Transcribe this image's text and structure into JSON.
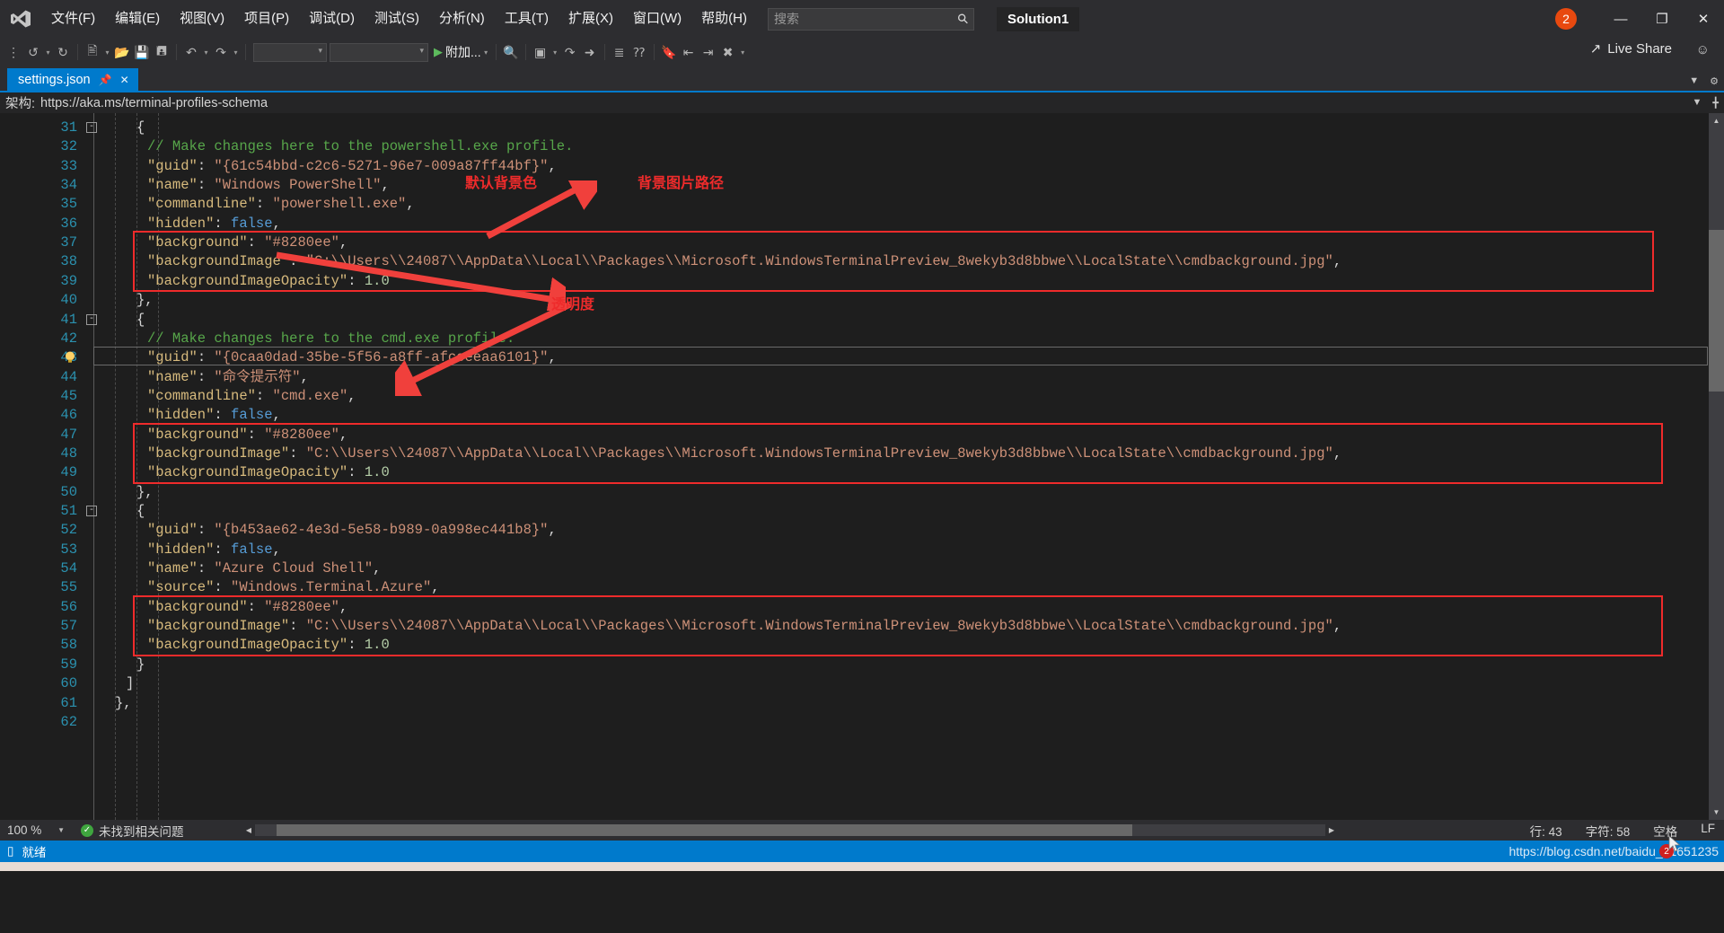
{
  "titlebar": {
    "logo_icon": "visual-studio-logo",
    "menus": [
      "文件(F)",
      "编辑(E)",
      "视图(V)",
      "项目(P)",
      "调试(D)",
      "测试(S)",
      "分析(N)",
      "工具(T)",
      "扩展(X)",
      "窗口(W)",
      "帮助(H)"
    ],
    "search_placeholder": "搜索",
    "search_value": "",
    "search_icon": "search-icon",
    "solution_name": "Solution1",
    "notification_count": "2",
    "minimize_icon": "minimize-icon",
    "maximize_icon": "maximize-icon",
    "close_icon": "close-icon"
  },
  "toolbar": {
    "back_icon": "navigate-back-icon",
    "forward_icon": "navigate-forward-icon",
    "new_project_icon": "new-project-icon",
    "open_icon": "open-file-icon",
    "save_icon": "save-icon",
    "save_all_icon": "save-all-icon",
    "undo_icon": "undo-icon",
    "redo_icon": "redo-icon",
    "config_combo": "",
    "platform_combo": "",
    "run_icon": "start-debug-icon",
    "attach_label": "附加...",
    "find_icon": "find-icon",
    "window_icon": "window-layout-icon",
    "indent_icon": "indent-icon",
    "comment_icon": "comment-icon",
    "bookmark_icon": "bookmark-icon",
    "live_share_label": "Live Share",
    "live_share_icon": "share-icon",
    "live_share_person_icon": "person-share-icon"
  },
  "tab": {
    "title": "settings.json",
    "pin_icon": "pin-icon",
    "close_icon": "close-tab-icon",
    "chevron_icon": "chevron-down-icon",
    "settings_icon": "gear-icon"
  },
  "schemabar": {
    "label": "架构:",
    "value": "https://aka.ms/terminal-profiles-schema",
    "chevron_icon": "chevron-down-icon",
    "split_icon": "split-editor-icon"
  },
  "editor": {
    "current_line": 43,
    "bulb_icon": "lightbulb-icon",
    "lines": [
      {
        "n": 31,
        "fold": "-",
        "indent": 3,
        "tokens": [
          {
            "t": "p",
            "v": "{"
          }
        ]
      },
      {
        "n": 32,
        "fold": "",
        "indent": 4,
        "tokens": [
          {
            "t": "c",
            "v": "// Make changes here to the powershell.exe profile."
          }
        ]
      },
      {
        "n": 33,
        "fold": "",
        "indent": 4,
        "tokens": [
          {
            "t": "k",
            "v": "\"guid\""
          },
          {
            "t": "p",
            "v": ": "
          },
          {
            "t": "s",
            "v": "\"{61c54bbd-c2c6-5271-96e7-009a87ff44bf}\""
          },
          {
            "t": "p",
            "v": ","
          }
        ]
      },
      {
        "n": 34,
        "fold": "",
        "indent": 4,
        "tokens": [
          {
            "t": "k",
            "v": "\"name\""
          },
          {
            "t": "p",
            "v": ": "
          },
          {
            "t": "s",
            "v": "\"Windows PowerShell\""
          },
          {
            "t": "p",
            "v": ","
          }
        ]
      },
      {
        "n": 35,
        "fold": "",
        "indent": 4,
        "tokens": [
          {
            "t": "k",
            "v": "\"commandline\""
          },
          {
            "t": "p",
            "v": ": "
          },
          {
            "t": "s",
            "v": "\"powershell.exe\""
          },
          {
            "t": "p",
            "v": ","
          }
        ]
      },
      {
        "n": 36,
        "fold": "",
        "indent": 4,
        "tokens": [
          {
            "t": "k",
            "v": "\"hidden\""
          },
          {
            "t": "p",
            "v": ": "
          },
          {
            "t": "b",
            "v": "false"
          },
          {
            "t": "p",
            "v": ","
          }
        ]
      },
      {
        "n": 37,
        "fold": "",
        "indent": 4,
        "tokens": [
          {
            "t": "k",
            "v": "\"background\""
          },
          {
            "t": "p",
            "v": ": "
          },
          {
            "t": "s",
            "v": "\"#8280ee\""
          },
          {
            "t": "p",
            "v": ","
          }
        ]
      },
      {
        "n": 38,
        "fold": "",
        "indent": 4,
        "tokens": [
          {
            "t": "k",
            "v": "\"backgroundImage\""
          },
          {
            "t": "p",
            "v": ": "
          },
          {
            "t": "s",
            "v": "\"C:\\\\Users\\\\24087\\\\AppData\\\\Local\\\\Packages\\\\Microsoft.WindowsTerminalPreview_8wekyb3d8bbwe\\\\LocalState\\\\cmdbackground.jpg\""
          },
          {
            "t": "p",
            "v": ","
          }
        ]
      },
      {
        "n": 39,
        "fold": "",
        "indent": 4,
        "tokens": [
          {
            "t": "k",
            "v": "\"backgroundImageOpacity\""
          },
          {
            "t": "p",
            "v": ": "
          },
          {
            "t": "n",
            "v": "1.0"
          }
        ]
      },
      {
        "n": 40,
        "fold": "",
        "indent": 3,
        "tokens": [
          {
            "t": "p",
            "v": "},"
          }
        ]
      },
      {
        "n": 41,
        "fold": "-",
        "indent": 3,
        "tokens": [
          {
            "t": "p",
            "v": "{"
          }
        ]
      },
      {
        "n": 42,
        "fold": "",
        "indent": 4,
        "tokens": [
          {
            "t": "c",
            "v": "// Make changes here to the cmd.exe profile."
          }
        ]
      },
      {
        "n": 43,
        "fold": "",
        "indent": 4,
        "tokens": [
          {
            "t": "k",
            "v": "\"guid\""
          },
          {
            "t": "p",
            "v": ": "
          },
          {
            "t": "s",
            "v": "\"{0caa0dad-35be-5f56-a8ff-afceeeaa6101}\""
          },
          {
            "t": "p",
            "v": ","
          }
        ]
      },
      {
        "n": 44,
        "fold": "",
        "indent": 4,
        "tokens": [
          {
            "t": "k",
            "v": "\"name\""
          },
          {
            "t": "p",
            "v": ": "
          },
          {
            "t": "s",
            "v": "\"命令提示符\""
          },
          {
            "t": "p",
            "v": ","
          }
        ]
      },
      {
        "n": 45,
        "fold": "",
        "indent": 4,
        "tokens": [
          {
            "t": "k",
            "v": "\"commandline\""
          },
          {
            "t": "p",
            "v": ": "
          },
          {
            "t": "s",
            "v": "\"cmd.exe\""
          },
          {
            "t": "p",
            "v": ","
          }
        ]
      },
      {
        "n": 46,
        "fold": "",
        "indent": 4,
        "tokens": [
          {
            "t": "k",
            "v": "\"hidden\""
          },
          {
            "t": "p",
            "v": ": "
          },
          {
            "t": "b",
            "v": "false"
          },
          {
            "t": "p",
            "v": ","
          }
        ]
      },
      {
        "n": 47,
        "fold": "",
        "indent": 4,
        "tokens": [
          {
            "t": "k",
            "v": "\"background\""
          },
          {
            "t": "p",
            "v": ": "
          },
          {
            "t": "s",
            "v": "\"#8280ee\""
          },
          {
            "t": "p",
            "v": ","
          }
        ]
      },
      {
        "n": 48,
        "fold": "",
        "indent": 4,
        "tokens": [
          {
            "t": "k",
            "v": "\"backgroundImage\""
          },
          {
            "t": "p",
            "v": ": "
          },
          {
            "t": "s",
            "v": "\"C:\\\\Users\\\\24087\\\\AppData\\\\Local\\\\Packages\\\\Microsoft.WindowsTerminalPreview_8wekyb3d8bbwe\\\\LocalState\\\\cmdbackground.jpg\""
          },
          {
            "t": "p",
            "v": ","
          }
        ]
      },
      {
        "n": 49,
        "fold": "",
        "indent": 4,
        "tokens": [
          {
            "t": "k",
            "v": "\"backgroundImageOpacity\""
          },
          {
            "t": "p",
            "v": ": "
          },
          {
            "t": "n",
            "v": "1.0"
          }
        ]
      },
      {
        "n": 50,
        "fold": "",
        "indent": 3,
        "tokens": [
          {
            "t": "p",
            "v": "},"
          }
        ]
      },
      {
        "n": 51,
        "fold": "-",
        "indent": 3,
        "tokens": [
          {
            "t": "p",
            "v": "{"
          }
        ]
      },
      {
        "n": 52,
        "fold": "",
        "indent": 4,
        "tokens": [
          {
            "t": "k",
            "v": "\"guid\""
          },
          {
            "t": "p",
            "v": ": "
          },
          {
            "t": "s",
            "v": "\"{b453ae62-4e3d-5e58-b989-0a998ec441b8}\""
          },
          {
            "t": "p",
            "v": ","
          }
        ]
      },
      {
        "n": 53,
        "fold": "",
        "indent": 4,
        "tokens": [
          {
            "t": "k",
            "v": "\"hidden\""
          },
          {
            "t": "p",
            "v": ": "
          },
          {
            "t": "b",
            "v": "false"
          },
          {
            "t": "p",
            "v": ","
          }
        ]
      },
      {
        "n": 54,
        "fold": "",
        "indent": 4,
        "tokens": [
          {
            "t": "k",
            "v": "\"name\""
          },
          {
            "t": "p",
            "v": ": "
          },
          {
            "t": "s",
            "v": "\"Azure Cloud Shell\""
          },
          {
            "t": "p",
            "v": ","
          }
        ]
      },
      {
        "n": 55,
        "fold": "",
        "indent": 4,
        "tokens": [
          {
            "t": "k",
            "v": "\"source\""
          },
          {
            "t": "p",
            "v": ": "
          },
          {
            "t": "s",
            "v": "\"Windows.Terminal.Azure\""
          },
          {
            "t": "p",
            "v": ","
          }
        ]
      },
      {
        "n": 56,
        "fold": "",
        "indent": 4,
        "tokens": [
          {
            "t": "k",
            "v": "\"background\""
          },
          {
            "t": "p",
            "v": ": "
          },
          {
            "t": "s",
            "v": "\"#8280ee\""
          },
          {
            "t": "p",
            "v": ","
          }
        ]
      },
      {
        "n": 57,
        "fold": "",
        "indent": 4,
        "tokens": [
          {
            "t": "k",
            "v": "\"backgroundImage\""
          },
          {
            "t": "p",
            "v": ": "
          },
          {
            "t": "s",
            "v": "\"C:\\\\Users\\\\24087\\\\AppData\\\\Local\\\\Packages\\\\Microsoft.WindowsTerminalPreview_8wekyb3d8bbwe\\\\LocalState\\\\cmdbackground.jpg\""
          },
          {
            "t": "p",
            "v": ","
          }
        ]
      },
      {
        "n": 58,
        "fold": "",
        "indent": 4,
        "tokens": [
          {
            "t": "k",
            "v": "\"backgroundImageOpacity\""
          },
          {
            "t": "p",
            "v": ": "
          },
          {
            "t": "n",
            "v": "1.0"
          }
        ]
      },
      {
        "n": 59,
        "fold": "",
        "indent": 3,
        "tokens": [
          {
            "t": "p",
            "v": "}"
          }
        ]
      },
      {
        "n": 60,
        "fold": "",
        "indent": 2,
        "tokens": [
          {
            "t": "p",
            "v": "]"
          }
        ]
      },
      {
        "n": 61,
        "fold": "",
        "indent": 1,
        "tokens": [
          {
            "t": "p",
            "v": "},"
          }
        ]
      },
      {
        "n": 62,
        "fold": "",
        "indent": 1,
        "tokens": []
      }
    ]
  },
  "annotations": [
    {
      "id": "default-bg-color",
      "text": "默认背景色"
    },
    {
      "id": "bg-image-path",
      "text": "背景图片路径"
    },
    {
      "id": "opacity",
      "text": "透明度"
    }
  ],
  "editor_status": {
    "zoom_level": "100 %",
    "zoom_caret_icon": "chevron-down-icon",
    "issue_icon": "check-circle-icon",
    "issue_text": "未找到相关问题",
    "scroll_left_icon": "scroll-left-icon",
    "scroll_right_icon": "scroll-right-icon",
    "line_label": "行: 43",
    "char_label": "字符: 58",
    "space_label": "空格",
    "eol_label": "LF"
  },
  "statusbar": {
    "icon": "ready-icon",
    "text": "就绪",
    "watermark": "https://blog.csdn.net/baidu_41651235",
    "badge": "2"
  },
  "colors": {
    "accent": "#007acc",
    "chrome": "#2d2d30",
    "editor_bg": "#1e1e1e",
    "annotation_red": "#ee2b2b",
    "string": "#ce9178",
    "property": "#d7ba7d",
    "comment": "#57a64a",
    "keyword": "#569cd6",
    "number": "#b5cea8",
    "linenumber": "#2b91af"
  }
}
